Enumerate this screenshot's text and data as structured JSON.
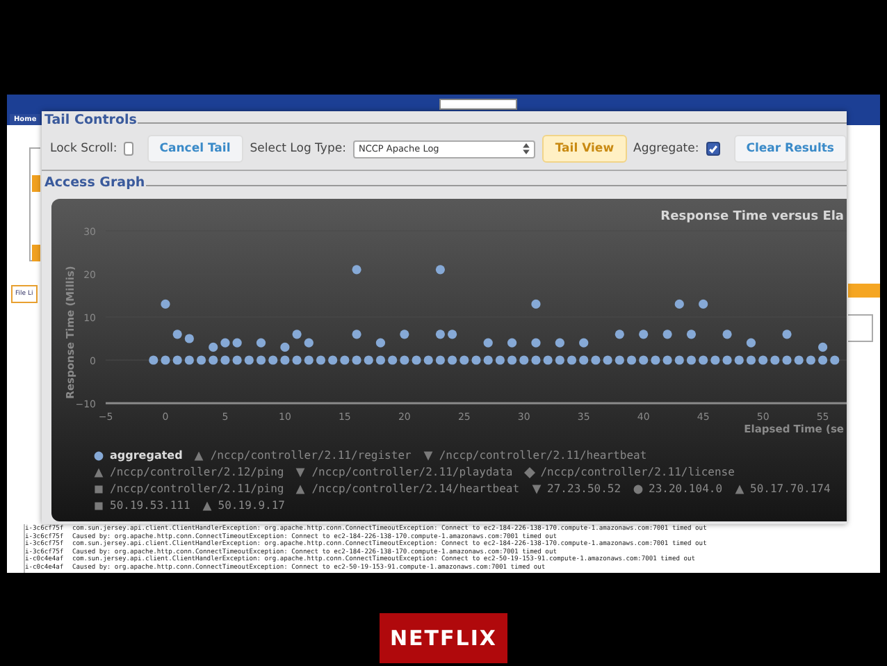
{
  "background_app": {
    "nav_tab": "Home",
    "side_tab": "File Li"
  },
  "tail_controls": {
    "title": "Tail Controls",
    "lock_scroll": {
      "label": "Lock Scroll:",
      "checked": false
    },
    "cancel_button": "Cancel Tail",
    "log_type": {
      "label": "Select Log Type:",
      "value": "NCCP Apache Log"
    },
    "tail_view_button": "Tail View",
    "aggregate": {
      "label": "Aggregate:",
      "checked": true
    },
    "clear_button": "Clear Results"
  },
  "access_graph": {
    "title": "Access Graph",
    "chart_data": {
      "type": "scatter",
      "title": "Response Time versus Ela",
      "xlabel": "Elapsed Time (se",
      "ylabel": "Response Time (Millis)",
      "xlim": [
        -5,
        57
      ],
      "ylim": [
        -10,
        30
      ],
      "xticks": [
        -5,
        0,
        5,
        10,
        15,
        20,
        25,
        30,
        35,
        40,
        45,
        50,
        55
      ],
      "yticks": [
        -10,
        0,
        10,
        20,
        30
      ],
      "x": [
        -1,
        0,
        1,
        2,
        3,
        4,
        5,
        6,
        7,
        8,
        9,
        10,
        11,
        12,
        13,
        14,
        15,
        16,
        17,
        18,
        19,
        20,
        21,
        22,
        23,
        24,
        25,
        26,
        27,
        28,
        29,
        30,
        31,
        32,
        33,
        34,
        35,
        36,
        37,
        38,
        39,
        40,
        41,
        42,
        43,
        44,
        45,
        46,
        47,
        48,
        49,
        50,
        51,
        52,
        53,
        54,
        55,
        56,
        0,
        1,
        2,
        4,
        5,
        6,
        8,
        10,
        11,
        12,
        16,
        16,
        18,
        20,
        23,
        23,
        24,
        27,
        29,
        31,
        31,
        33,
        35,
        38,
        40,
        42,
        43,
        44,
        45,
        47,
        49,
        52,
        55
      ],
      "series": [
        {
          "name": "aggregated",
          "color": "#86a9d6",
          "values": [
            0,
            0,
            0,
            0,
            0,
            0,
            0,
            0,
            0,
            0,
            0,
            0,
            0,
            0,
            0,
            0,
            0,
            0,
            0,
            0,
            0,
            0,
            0,
            0,
            0,
            0,
            0,
            0,
            0,
            0,
            0,
            0,
            0,
            0,
            0,
            0,
            0,
            0,
            0,
            0,
            0,
            0,
            0,
            0,
            0,
            0,
            0,
            0,
            0,
            0,
            0,
            0,
            0,
            0,
            0,
            0,
            0,
            0,
            13,
            6,
            5,
            3,
            4,
            4,
            4,
            3,
            6,
            4,
            21,
            6,
            4,
            6,
            21,
            6,
            6,
            4,
            4,
            13,
            4,
            4,
            4,
            6,
            6,
            6,
            13,
            6,
            13,
            6,
            4,
            6,
            3
          ]
        }
      ]
    },
    "legend": [
      {
        "label": "/nccp/controller/2.11/register",
        "kind": "triangle",
        "dim": true
      },
      {
        "label": "/nccp/controller/2.11/heartbeat",
        "kind": "down",
        "dim": true
      },
      {
        "label": "/nccp/controller/2.12/ping",
        "kind": "triangle",
        "dim": true
      },
      {
        "label": "/nccp/controller/2.11/playdata",
        "kind": "down",
        "dim": true
      },
      {
        "label": "/nccp/controller/2.11/license",
        "kind": "diamond",
        "dim": true
      },
      {
        "label": "/nccp/controller/2.11/ping",
        "kind": "square",
        "dim": true
      },
      {
        "label": "/nccp/controller/2.14/heartbeat",
        "kind": "triangle",
        "dim": true
      },
      {
        "label": "27.23.50.52",
        "kind": "down",
        "dim": true
      },
      {
        "label": "23.20.104.0",
        "kind": "circle",
        "dim": true
      },
      {
        "label": "50.17.70.174",
        "kind": "triangle",
        "dim": true
      },
      {
        "label": "50.19.53.111",
        "kind": "square",
        "dim": true
      },
      {
        "label": "50.19.9.17",
        "kind": "triangle",
        "dim": true
      }
    ]
  },
  "log_lines": [
    {
      "id": "i-3c6cf75f",
      "text": "com.sun.jersey.api.client.ClientHandlerException: org.apache.http.conn.ConnectTimeoutException: Connect to ec2-184-226-138-170.compute-1.amazonaws.com:7001 timed out"
    },
    {
      "id": "i-3c6cf75f",
      "text": "Caused by: org.apache.http.conn.ConnectTimeoutException: Connect to ec2-184-226-138-170.compute-1.amazonaws.com:7001 timed out"
    },
    {
      "id": "i-3c6cf75f",
      "text": "com.sun.jersey.api.client.ClientHandlerException: org.apache.http.conn.ConnectTimeoutException: Connect to ec2-184-226-138-170.compute-1.amazonaws.com:7001 timed out"
    },
    {
      "id": "i-3c6cf75f",
      "text": "Caused by: org.apache.http.conn.ConnectTimeoutException: Connect to ec2-184-226-138-170.compute-1.amazonaws.com:7001 timed out"
    },
    {
      "id": "i-c0c4e4af",
      "text": "com.sun.jersey.api.client.ClientHandlerException: org.apache.http.conn.ConnectTimeoutException: Connect to ec2-50-19-153-91.compute-1.amazonaws.com:7001 timed out"
    },
    {
      "id": "i-c0c4e4af",
      "text": "Caused by: org.apache.http.conn.ConnectTimeoutException: Connect to ec2-50-19-153-91.compute-1.amazonaws.com:7001 timed out"
    }
  ],
  "slide_logo": "NETFLIX"
}
